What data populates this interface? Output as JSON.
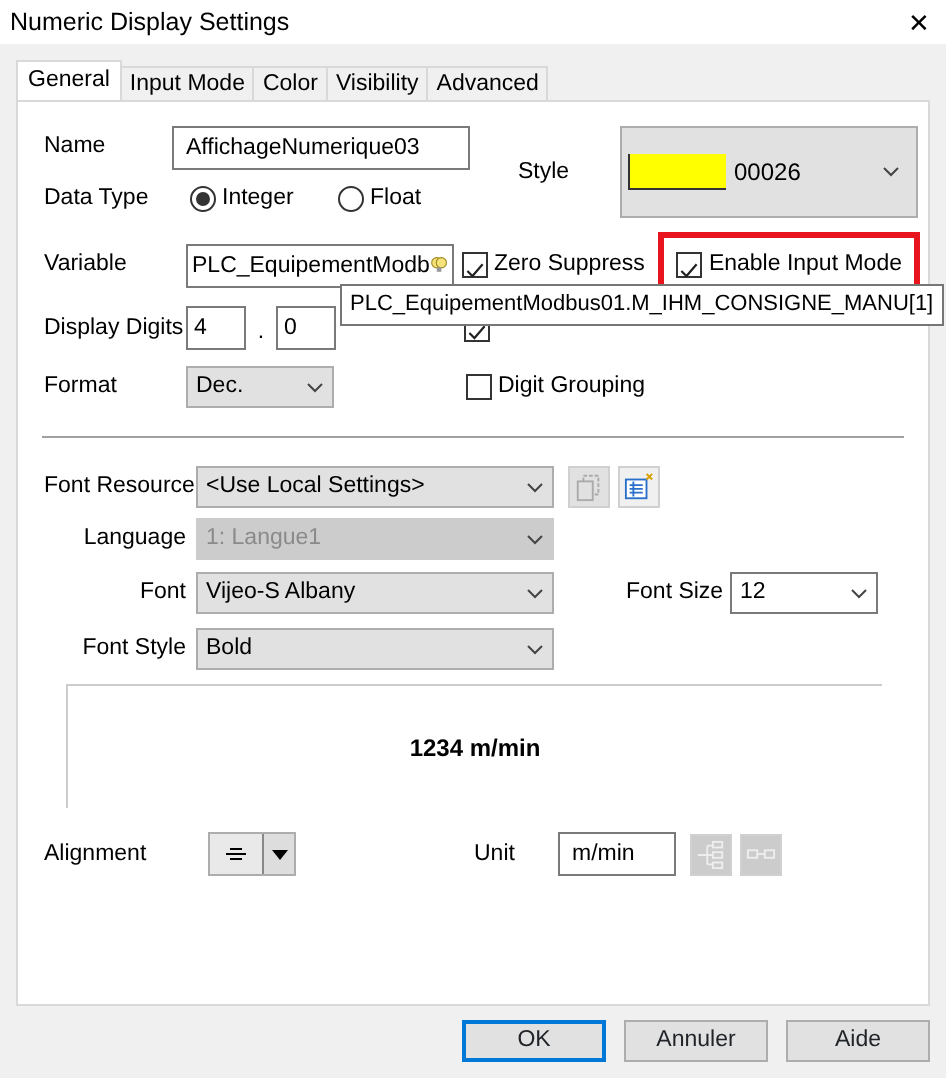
{
  "window": {
    "title": "Numeric Display Settings",
    "close": "✕"
  },
  "tabs": [
    {
      "label": "General",
      "selected": true
    },
    {
      "label": "Input Mode",
      "selected": false
    },
    {
      "label": "Color",
      "selected": false
    },
    {
      "label": "Visibility",
      "selected": false
    },
    {
      "label": "Advanced",
      "selected": false
    }
  ],
  "name": {
    "label": "Name",
    "value": "AffichageNumerique03"
  },
  "style": {
    "label": "Style",
    "color": "#ffff00",
    "value": "00026"
  },
  "data_type": {
    "label": "Data Type",
    "options": [
      {
        "label": "Integer",
        "selected": true
      },
      {
        "label": "Float",
        "selected": false
      }
    ]
  },
  "variable": {
    "label": "Variable",
    "value": "PLC_EquipementModb"
  },
  "zero_suppress": {
    "label": "Zero Suppress",
    "checked": true
  },
  "enable_input_mode": {
    "label": "Enable Input Mode",
    "checked": true,
    "highlighted": true
  },
  "display_digits": {
    "label": "Display Digits",
    "integer": "4",
    "separator": ".",
    "decimal": "0"
  },
  "display_zeros": {
    "checked": true
  },
  "tooltip": "PLC_EquipementModbus01.M_IHM_CONSIGNE_MANU[1]",
  "format": {
    "label": "Format",
    "value": "Dec."
  },
  "digit_grouping": {
    "label": "Digit Grouping",
    "checked": false
  },
  "font_resource": {
    "label": "Font Resource",
    "value": "<Use Local Settings>"
  },
  "language": {
    "label": "Language",
    "value": "1: Langue1",
    "disabled": true
  },
  "font": {
    "label": "Font",
    "value": "Vijeo-S Albany"
  },
  "font_size": {
    "label": "Font Size",
    "value": "12"
  },
  "font_style": {
    "label": "Font Style",
    "value": "Bold"
  },
  "preview": "1234 m/min",
  "alignment": {
    "label": "Alignment"
  },
  "unit": {
    "label": "Unit",
    "value": "m/min"
  },
  "buttons": [
    {
      "label": "OK",
      "default": true
    },
    {
      "label": "Annuler",
      "default": false
    },
    {
      "label": "Aide",
      "default": false
    }
  ]
}
